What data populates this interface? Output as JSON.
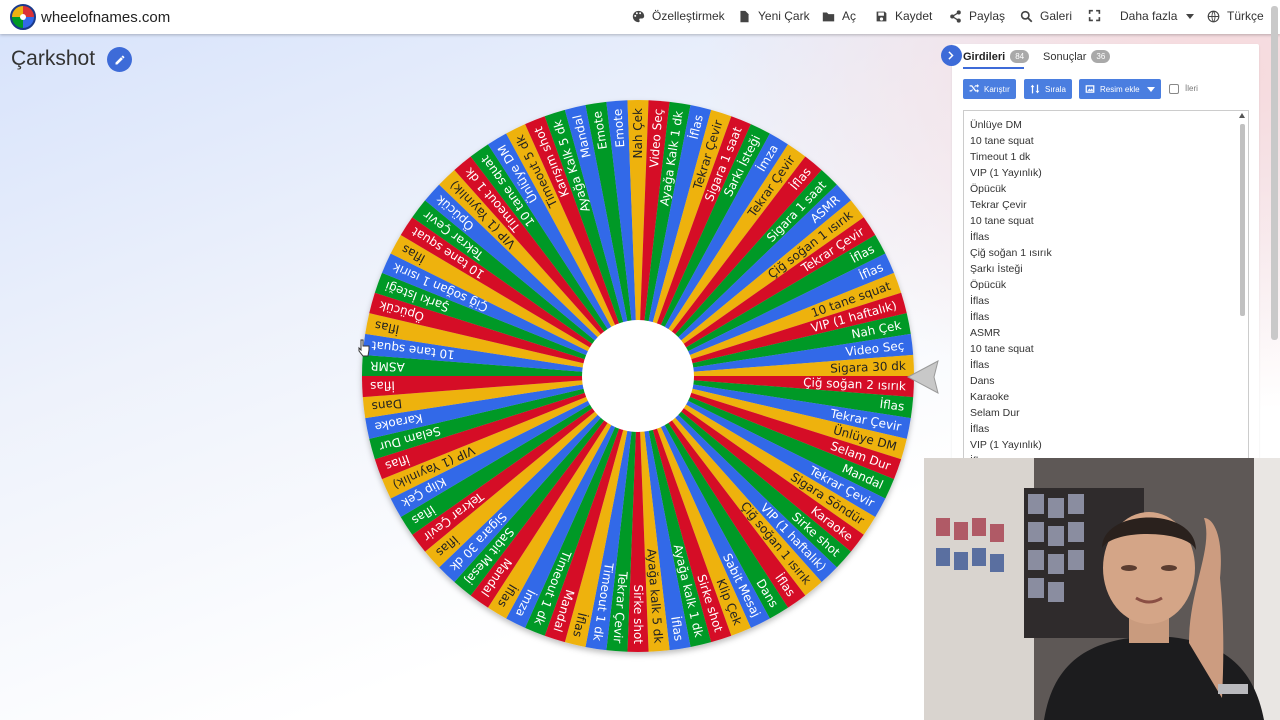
{
  "header": {
    "site_title": "wheelofnames.com",
    "nav": [
      {
        "label": "Özelleştirmek",
        "icon": "palette-icon"
      },
      {
        "label": "Yeni Çark",
        "icon": "file-icon"
      },
      {
        "label": "Aç",
        "icon": "folder-icon"
      },
      {
        "label": "Kaydet",
        "icon": "save-icon"
      },
      {
        "label": "Paylaş",
        "icon": "share-icon"
      },
      {
        "label": "Galeri",
        "icon": "search-icon"
      },
      {
        "label": "",
        "icon": "fullscreen-icon"
      },
      {
        "label": "Daha fazla",
        "icon": "chevron-down-icon"
      },
      {
        "label": "Türkçe",
        "icon": "globe-icon"
      }
    ]
  },
  "wheel": {
    "title": "Çarkshot",
    "colors": [
      "#009925",
      "#3369e8",
      "#eeb211",
      "#d50f25"
    ],
    "segments": [
      "Emote",
      "Emote",
      "Nah Çek",
      "Video Seç",
      "Ayağa Kalk 1 dk",
      "İflas",
      "Tekrar Çevir",
      "Sigara 1 saat",
      "Sarkı İsteği",
      "İmza",
      "Tekrar Çevir",
      "İflas",
      "Sigara 1 saat",
      "ASMR",
      "Çiğ soğan 1 ısırık",
      "Tekrar Çevir",
      "İflas",
      "İflas",
      "10 tane squat",
      "VIP (1 haftalık)",
      "Nah Çek",
      "Video Seç",
      "Sigara 30 dk",
      "Çiğ soğan 2 ısırık",
      "İflas",
      "Tekrar Çevir",
      "Ünlüye DM",
      "Selam Dur",
      "Mandal",
      "Tekrar Çevir",
      "Sigara Söndür",
      "Karaoke",
      "Sirke shot",
      "VIP (1 haftalık)",
      "Çiğ soğan 1 ısırık",
      "İflas",
      "Dans",
      "Sabit Mesaj",
      "Klip Çek",
      "Sirke shot",
      "Ayağa kalk 1 dk",
      "İflas",
      "Ayağa kalk 5 dk",
      "Sirke shot",
      "Tekrar Çevir",
      "Timeout 1 dk",
      "İflas",
      "Mandal",
      "Timeout 1 dk",
      "İmza",
      "İflas",
      "Mandal",
      "Sabit Mesaj",
      "Sigara 30 dk",
      "İflas",
      "Tekrar Çevir",
      "İflas",
      "Klip Çek",
      "VIP (1 Yayınlık)",
      "İflas",
      "Selam Dur",
      "Karaoke",
      "Dans",
      "İflas",
      "ASMR",
      "10 tane squat",
      "İflas",
      "Öpücük",
      "Şarkı İsteği",
      "Çiğ soğan 1 ısırık",
      "İflas",
      "10 tane squat",
      "Tekrar Çevir",
      "Öpücük",
      "VIP (1 Yayınlık)",
      "Timeout 1 dk",
      "10 tane squat",
      "Ünlüye DM",
      "Timeout 5 dk",
      "Karışım shot",
      "Ayağa Kalk 5 dk",
      "Mandal"
    ]
  },
  "panel": {
    "tabs": [
      {
        "label": "Girdileri",
        "count": "84"
      },
      {
        "label": "Sonuçlar",
        "count": "36"
      }
    ],
    "buttons": {
      "shuffle": "Karıştır",
      "sort": "Sırala",
      "add_image": "Resim ekle"
    },
    "advanced_label": "İleri",
    "entries": [
      "Ünlüye DM",
      "10 tane squat",
      "Timeout 1 dk",
      "VIP (1 Yayınlık)",
      "Öpücük",
      "Tekrar Çevir",
      "10 tane squat",
      "İflas",
      "Çiğ soğan 1 ısırık",
      "Şarkı İsteği",
      "Öpücük",
      "İflas",
      "İflas",
      "ASMR",
      "10 tane squat",
      "İflas",
      "Dans",
      "Karaoke",
      "Selam Dur",
      "İflas",
      "VIP (1 Yayınlık)",
      "İflas"
    ]
  }
}
